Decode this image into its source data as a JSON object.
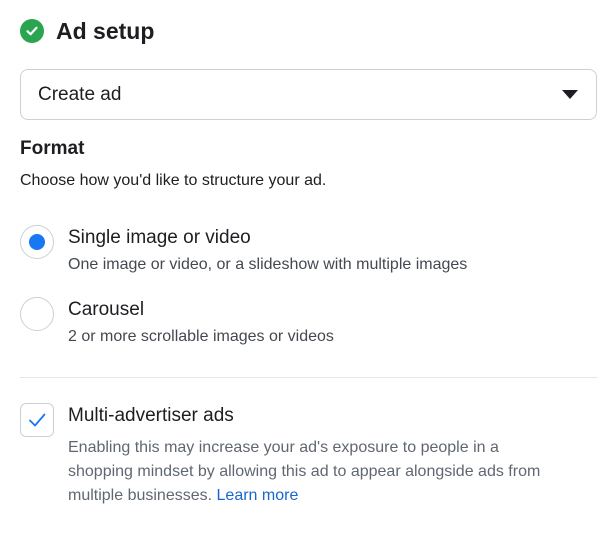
{
  "header": {
    "title": "Ad setup",
    "status_color": "#2aa44f",
    "status_icon": "check-circle-icon"
  },
  "dropdown": {
    "value": "Create ad"
  },
  "format": {
    "title": "Format",
    "description": "Choose how you'd like to structure your ad.",
    "options": [
      {
        "label": "Single image or video",
        "description": "One image or video, or a slideshow with multiple images",
        "selected": true
      },
      {
        "label": "Carousel",
        "description": "2 or more scrollable images or videos",
        "selected": false
      }
    ]
  },
  "multi_advertiser": {
    "label": "Multi-advertiser ads",
    "checked": true,
    "description": "Enabling this may increase your ad's exposure to people in a shopping mindset by allowing this ad to appear alongside ads from multiple businesses.",
    "link_text": "Learn more"
  },
  "colors": {
    "accent": "#1877f2",
    "link": "#1a66d1"
  }
}
